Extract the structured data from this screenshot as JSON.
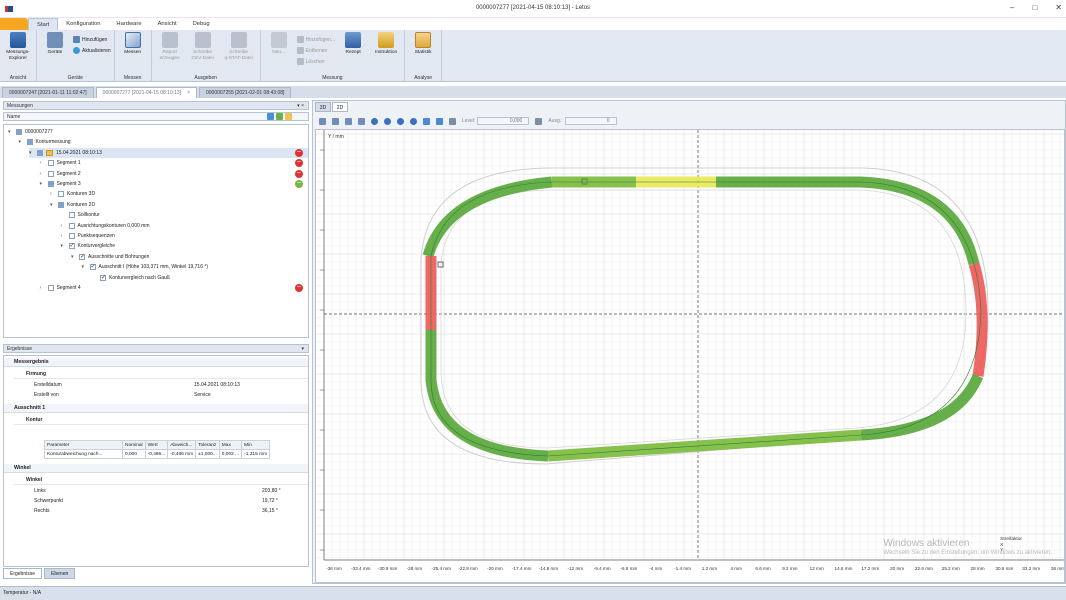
{
  "window": {
    "title": "0000007277 [2021-04-15 08:10:13] - Letos",
    "controls": [
      "–",
      "□",
      "✕"
    ]
  },
  "menu": {
    "tabs": [
      "Start",
      "Konfiguration",
      "Hardware",
      "Ansicht",
      "Debug"
    ],
    "active": "Start"
  },
  "ribbon": {
    "groups": [
      {
        "name": "Ansicht",
        "buttons": [
          {
            "label": "Messungs-\nExplorer",
            "icon": "explorer-icon"
          }
        ]
      },
      {
        "name": "Geräte",
        "big": [
          {
            "label": "Geräte",
            "icon": "devices-icon"
          }
        ],
        "small": [
          {
            "label": "Hinzufügen",
            "icon": "add-device-icon"
          },
          {
            "label": "Aktualisieren",
            "icon": "refresh-icon"
          }
        ]
      },
      {
        "name": "Messen",
        "buttons": [
          {
            "label": "Messen",
            "icon": "measure-icon"
          }
        ]
      },
      {
        "name": "Ausgeben",
        "buttons": [
          {
            "label": "Report\nerzeugen",
            "icon": "report-icon",
            "disabled": true
          },
          {
            "label": "Schreibe\nCSV-Datei",
            "icon": "csv-icon",
            "disabled": true
          },
          {
            "label": "Schreibe\nq-STAT-Datei",
            "icon": "qstat-icon",
            "disabled": true
          }
        ]
      },
      {
        "name": "Messung",
        "big": [
          {
            "label": "Neu...",
            "icon": "new-icon",
            "disabled": true
          }
        ],
        "small": [
          {
            "label": "Hinzufügen...",
            "icon": "plus-icon",
            "disabled": true
          },
          {
            "label": "Entfernen",
            "icon": "minus-icon",
            "disabled": true
          },
          {
            "label": "Löschen",
            "icon": "delete-icon",
            "disabled": true
          }
        ],
        "extra": [
          {
            "label": "Rezept",
            "icon": "recipe-icon"
          },
          {
            "label": "Instruktion",
            "icon": "instruction-icon"
          }
        ]
      },
      {
        "name": "Analyse",
        "buttons": [
          {
            "label": "Statistik",
            "icon": "statistics-icon"
          }
        ]
      }
    ]
  },
  "doc_tabs": [
    {
      "label": "0000007247 [2021-01-11 11:02:47]"
    },
    {
      "label": "0000007277 [2021-04-15 08:10:13]",
      "active": true,
      "close": "×"
    },
    {
      "label": "0000007255 [2021-02-01 08:43:08]"
    }
  ],
  "measurements_panel": {
    "title": "Messungen",
    "column": "Name",
    "pin": "▾ ×"
  },
  "tree": [
    {
      "label": "0000007277",
      "indent": 0,
      "exp": "▾",
      "check": "partial"
    },
    {
      "label": "Konturmessung",
      "indent": 1,
      "exp": "▾",
      "check": "partial"
    },
    {
      "label": "15.04.2021 08:10:13",
      "indent": 2,
      "exp": "▾",
      "check": "partial",
      "selected": true,
      "status": "red",
      "icon": true
    },
    {
      "label": "Segment 1",
      "indent": 3,
      "exp": "›",
      "check": "none",
      "status": "red"
    },
    {
      "label": "Segment 2",
      "indent": 3,
      "exp": "›",
      "check": "none",
      "status": "red"
    },
    {
      "label": "Segment 3",
      "indent": 3,
      "exp": "▾",
      "check": "partial",
      "status": "green"
    },
    {
      "label": "Konturen 3D",
      "indent": 4,
      "exp": "›",
      "check": "none"
    },
    {
      "label": "Konturen 2D",
      "indent": 4,
      "exp": "▾",
      "check": "partial"
    },
    {
      "label": "Sollkontur",
      "indent": 5,
      "exp": "",
      "check": "none"
    },
    {
      "label": "Ausrichtungskonturen 0,000 mm",
      "indent": 5,
      "exp": "›",
      "check": "none"
    },
    {
      "label": "Punktsequenzen",
      "indent": 5,
      "exp": "›",
      "check": "none"
    },
    {
      "label": "Konturvergleiche",
      "indent": 5,
      "exp": "▾",
      "check": "on"
    },
    {
      "label": "Ausschnitte und Bohrungen",
      "indent": 6,
      "exp": "▾",
      "check": "on"
    },
    {
      "label": "Ausschnitt I (Höhe 103,371 mm, Winkel 19,716 °)",
      "indent": 7,
      "exp": "▾",
      "check": "on"
    },
    {
      "label": "Konturvergleich nach Gauß",
      "indent": 8,
      "exp": "",
      "check": "on"
    },
    {
      "label": "Segment 4",
      "indent": 3,
      "exp": "›",
      "check": "none",
      "status": "red"
    }
  ],
  "results_panel": {
    "title": "Ergebnisse",
    "pin": "▾",
    "header": "Messergebnis",
    "firmung": {
      "title": "Firmung",
      "rows": [
        {
          "k": "Erstelldatum",
          "v": "15.04.2021 08:10:13"
        },
        {
          "k": "Erstellt von",
          "v": "Service"
        }
      ]
    },
    "ausschnitt": {
      "title": "Ausschnitt 1",
      "sub": "Kontur",
      "columns": [
        "Parameter",
        "Nominal",
        "Wert",
        "Abweich...",
        "Toleranz",
        "Max",
        "Min"
      ],
      "rows": [
        [
          "Konturabweichung nach...",
          "0,000",
          "-0,486...",
          "-0,486 mm",
          "±1,000...",
          "0,002 ...",
          "-1,315 mm"
        ]
      ]
    },
    "winkel": {
      "title": "Winkel",
      "sub": "Winkel",
      "rows": [
        {
          "k": "Links",
          "v": "203,80 °"
        },
        {
          "k": "Schwerpunkt",
          "v": "19,72 °"
        },
        {
          "k": "Rechts",
          "v": "36,15 °"
        }
      ]
    }
  },
  "bottom_tabs": [
    "Ergebnisse",
    "Ebenen"
  ],
  "status": "Temperatur - N/A",
  "view": {
    "tabs": [
      "3D",
      "2D"
    ],
    "active_tab": "2D",
    "toolbar_fields": [
      {
        "label": "Level:",
        "value": "0,000"
      },
      {
        "label": "Ausg.:",
        "value": "0"
      }
    ],
    "axis_unit": "Y / mm",
    "x_ticks": [
      "-36 mm",
      "-33.4 mm",
      "-30.8 mm",
      "-28 mm",
      "-25.4 mm",
      "-22.8 mm",
      "-20 mm",
      "-17.4 mm",
      "-14.8 mm",
      "-12 mm",
      "-9.4 mm",
      "-6.8 mm",
      "-4 mm",
      "-1.4 mm",
      "1.2 mm",
      "4 mm",
      "6.6 mm",
      "9.2 mm",
      "12 mm",
      "14.6 mm",
      "17.2 mm",
      "20 mm",
      "22.6 mm",
      "25.2 mm",
      "28 mm",
      "30.6 mm",
      "33.2 mm",
      "36 mm"
    ],
    "legend": [
      "Streifaktor",
      "X",
      "Y"
    ],
    "watermark": "Windows aktivieren",
    "watermark_sub": "Wechseln Sie zu den Einstellungen, um Windows zu aktivieren."
  }
}
